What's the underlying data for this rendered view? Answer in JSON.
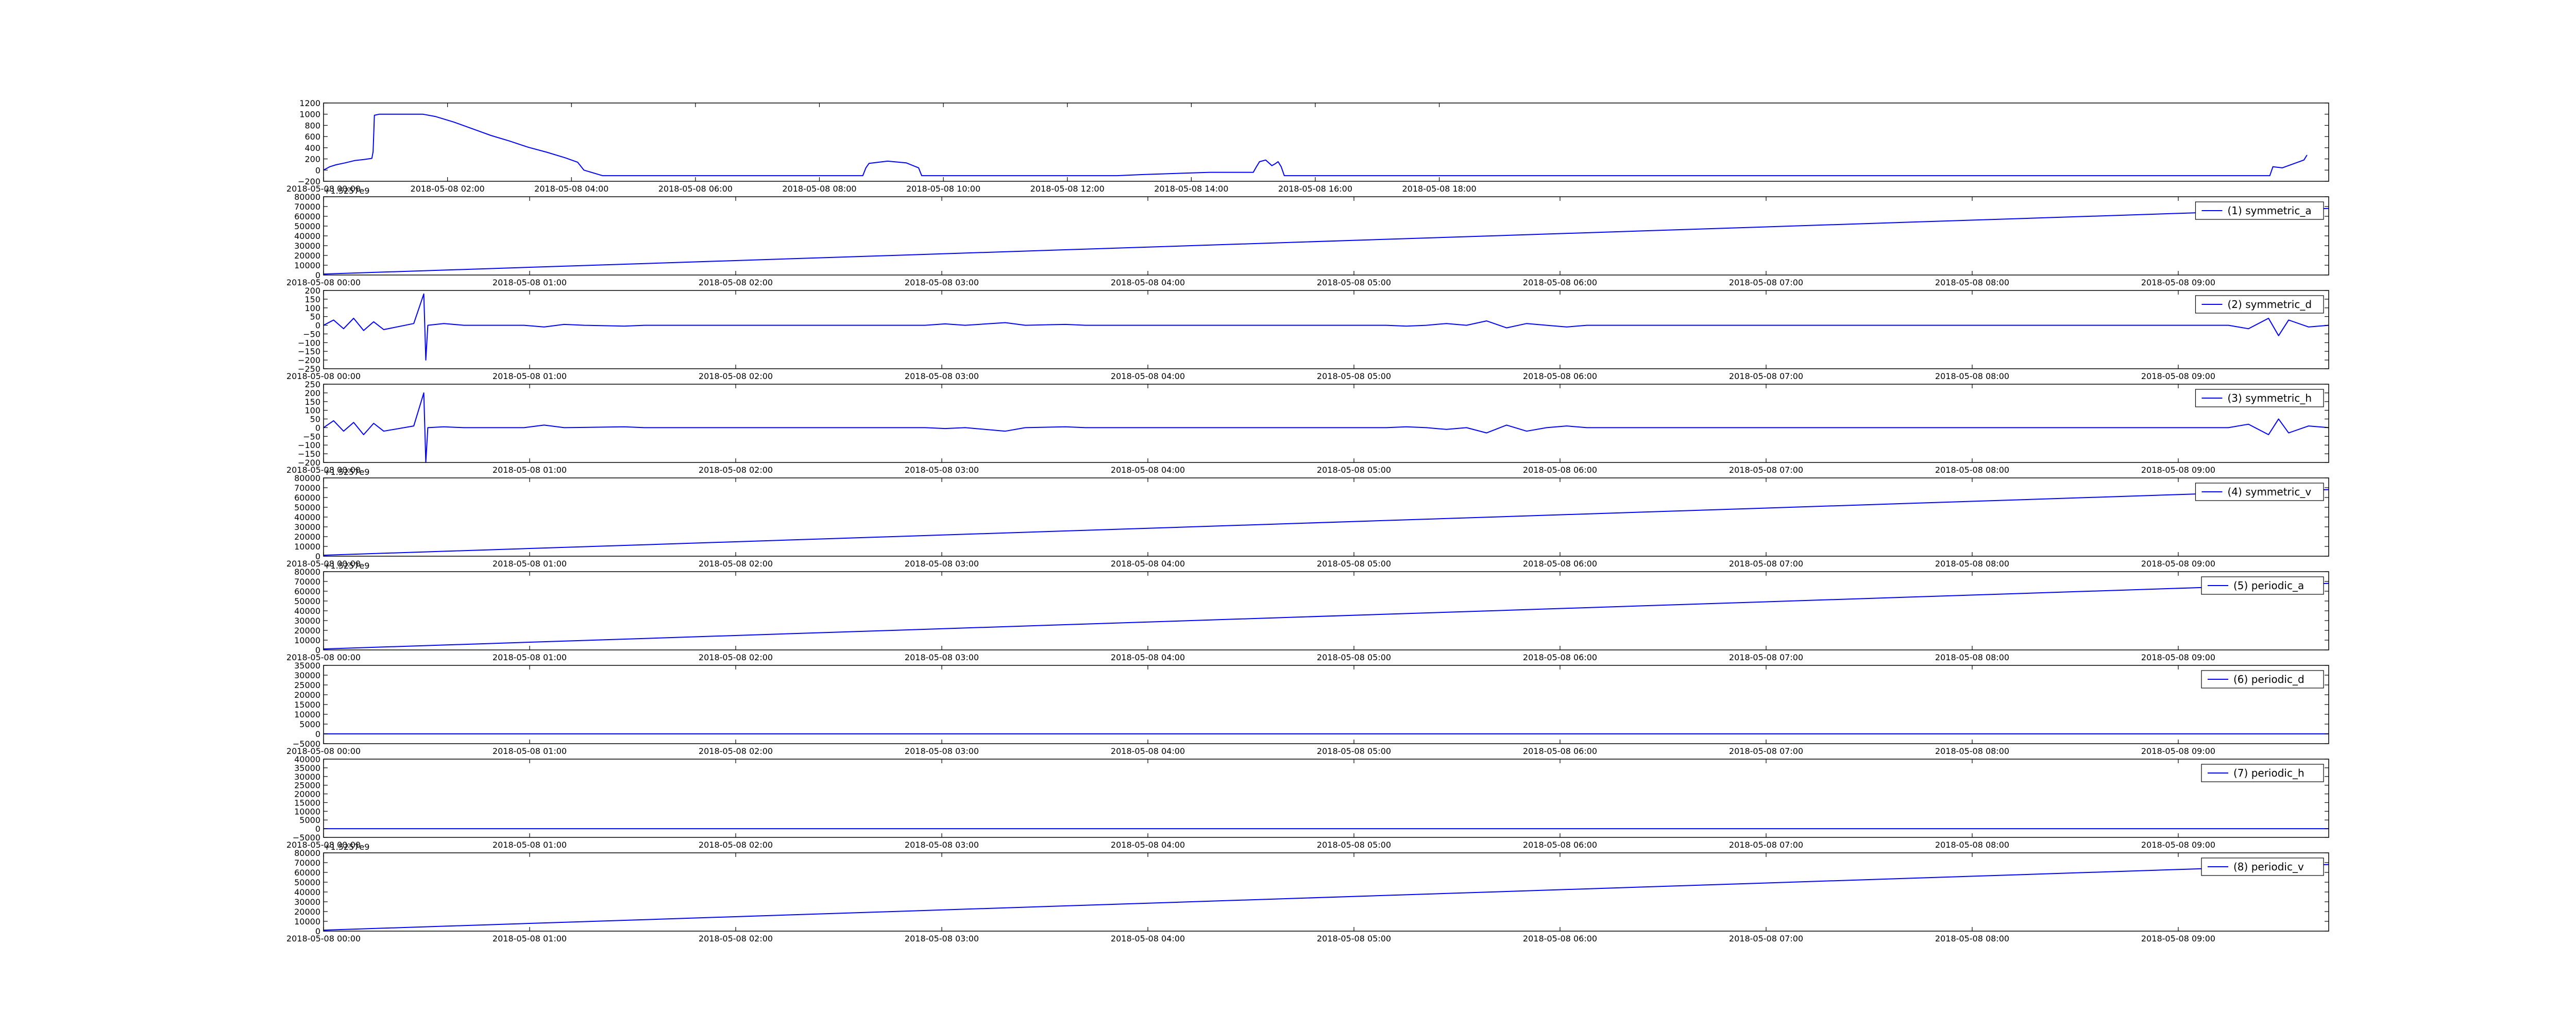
{
  "figure": {
    "line_color": "#0000ff",
    "legend_loc": "upper right"
  },
  "chart_data": [
    {
      "type": "line",
      "series": [
        {
          "values": [
            [
              0,
              0
            ],
            [
              0.1,
              60
            ],
            [
              0.2,
              95
            ],
            [
              0.35,
              130
            ],
            [
              0.5,
              170
            ],
            [
              0.65,
              190
            ],
            [
              0.78,
              210
            ],
            [
              0.8,
              330
            ],
            [
              0.82,
              980
            ],
            [
              0.9,
              1000
            ],
            [
              1.2,
              1000
            ],
            [
              1.6,
              1000
            ],
            [
              1.8,
              960
            ],
            [
              2.1,
              860
            ],
            [
              2.4,
              740
            ],
            [
              2.7,
              620
            ],
            [
              3.0,
              520
            ],
            [
              3.3,
              410
            ],
            [
              3.6,
              320
            ],
            [
              3.9,
              220
            ],
            [
              4.1,
              140
            ],
            [
              4.2,
              0
            ],
            [
              4.5,
              -100
            ],
            [
              5.0,
              -100
            ],
            [
              6.0,
              -100
            ],
            [
              7.0,
              -100
            ],
            [
              8.7,
              -100
            ],
            [
              8.75,
              40
            ],
            [
              8.8,
              120
            ],
            [
              9.1,
              160
            ],
            [
              9.4,
              130
            ],
            [
              9.6,
              40
            ],
            [
              9.65,
              -100
            ],
            [
              11.0,
              -100
            ],
            [
              12.8,
              -100
            ],
            [
              13.2,
              -80
            ],
            [
              14.3,
              -40
            ],
            [
              15.0,
              -40
            ],
            [
              15.05,
              60
            ],
            [
              15.1,
              150
            ],
            [
              15.2,
              180
            ],
            [
              15.3,
              80
            ],
            [
              15.35,
              110
            ],
            [
              15.4,
              150
            ],
            [
              15.45,
              60
            ],
            [
              15.5,
              -100
            ],
            [
              17.0,
              -100
            ],
            [
              18.0,
              -100
            ],
            [
              19.0,
              -100
            ],
            [
              20.0,
              -100
            ],
            [
              21.0,
              -100
            ],
            [
              22.0,
              -100
            ],
            [
              23.0,
              -100
            ],
            [
              24.0,
              -100
            ],
            [
              25.0,
              -100
            ],
            [
              26.0,
              -100
            ],
            [
              27.0,
              -100
            ],
            [
              28.0,
              -100
            ],
            [
              29.0,
              -100
            ],
            [
              30.0,
              -100
            ],
            [
              31.0,
              -100
            ],
            [
              31.4,
              -100
            ],
            [
              31.45,
              60
            ],
            [
              31.6,
              40
            ],
            [
              31.75,
              100
            ],
            [
              31.85,
              140
            ],
            [
              31.95,
              180
            ],
            [
              32.0,
              270
            ]
          ]
        }
      ],
      "x_axis": {
        "ticks": [
          "2018-05-08 00:00",
          "2018-05-08 02:00",
          "2018-05-08 04:00",
          "2018-05-08 06:00",
          "2018-05-08 08:00",
          "2018-05-08 10:00",
          "2018-05-08 12:00",
          "2018-05-08 14:00",
          "2018-05-08 16:00",
          "2018-05-08 18:00"
        ],
        "unit": "hour"
      },
      "ylim": [
        -200,
        1200
      ],
      "yticks": [
        "1200",
        "1000",
        "800",
        "600",
        "400",
        "200",
        "0",
        "−200"
      ],
      "xlim_hours": [
        0,
        32.35
      ],
      "offset_text": ""
    },
    {
      "type": "line",
      "series": [
        {
          "values": [
            [
              0,
              1000
            ],
            [
              1,
              68000
            ]
          ]
        }
      ],
      "x_axis": {
        "ticks": [
          "2018-05-08 00:00",
          "2018-05-08 01:00",
          "2018-05-08 02:00",
          "2018-05-08 03:00",
          "2018-05-08 04:00",
          "2018-05-08 05:00",
          "2018-05-08 06:00",
          "2018-05-08 07:00",
          "2018-05-08 08:00",
          "2018-05-08 09:00"
        ]
      },
      "ylim": [
        0,
        80000
      ],
      "yticks": [
        "80000",
        "70000",
        "60000",
        "50000",
        "40000",
        "30000",
        "20000",
        "10000",
        "0"
      ],
      "legend": [
        "(1) symmetric_a"
      ],
      "offset_text": "+1.5257e9"
    },
    {
      "type": "line",
      "series": [
        {
          "values": [
            [
              0,
              0
            ],
            [
              0.005,
              30
            ],
            [
              0.01,
              -20
            ],
            [
              0.015,
              40
            ],
            [
              0.02,
              -30
            ],
            [
              0.025,
              20
            ],
            [
              0.03,
              -25
            ],
            [
              0.045,
              10
            ],
            [
              0.05,
              180
            ],
            [
              0.051,
              -200
            ],
            [
              0.052,
              0
            ],
            [
              0.06,
              10
            ],
            [
              0.07,
              0
            ],
            [
              0.1,
              0
            ],
            [
              0.11,
              -10
            ],
            [
              0.12,
              5
            ],
            [
              0.13,
              0
            ],
            [
              0.15,
              -5
            ],
            [
              0.16,
              0
            ],
            [
              0.3,
              0
            ],
            [
              0.31,
              8
            ],
            [
              0.32,
              0
            ],
            [
              0.34,
              15
            ],
            [
              0.35,
              0
            ],
            [
              0.37,
              5
            ],
            [
              0.38,
              0
            ],
            [
              0.53,
              0
            ],
            [
              0.54,
              -5
            ],
            [
              0.55,
              0
            ],
            [
              0.56,
              10
            ],
            [
              0.57,
              0
            ],
            [
              0.58,
              25
            ],
            [
              0.59,
              -15
            ],
            [
              0.6,
              10
            ],
            [
              0.61,
              0
            ],
            [
              0.62,
              -10
            ],
            [
              0.63,
              0
            ],
            [
              0.95,
              0
            ],
            [
              0.96,
              -20
            ],
            [
              0.97,
              40
            ],
            [
              0.975,
              -60
            ],
            [
              0.98,
              30
            ],
            [
              0.99,
              -10
            ],
            [
              1,
              0
            ]
          ]
        }
      ],
      "x_axis": {
        "ticks": [
          "2018-05-08 00:00",
          "2018-05-08 01:00",
          "2018-05-08 02:00",
          "2018-05-08 03:00",
          "2018-05-08 04:00",
          "2018-05-08 05:00",
          "2018-05-08 06:00",
          "2018-05-08 07:00",
          "2018-05-08 08:00",
          "2018-05-08 09:00"
        ]
      },
      "ylim": [
        -250,
        200
      ],
      "yticks": [
        "200",
        "150",
        "100",
        "50",
        "0",
        "−50",
        "−100",
        "−150",
        "−200",
        "−250"
      ],
      "legend": [
        "(2) symmetric_d"
      ],
      "offset_text": ""
    },
    {
      "type": "line",
      "series": [
        {
          "values": [
            [
              0,
              0
            ],
            [
              0.005,
              40
            ],
            [
              0.01,
              -20
            ],
            [
              0.015,
              30
            ],
            [
              0.02,
              -40
            ],
            [
              0.025,
              25
            ],
            [
              0.03,
              -20
            ],
            [
              0.045,
              10
            ],
            [
              0.05,
              200
            ],
            [
              0.051,
              -200
            ],
            [
              0.052,
              0
            ],
            [
              0.06,
              5
            ],
            [
              0.07,
              0
            ],
            [
              0.1,
              0
            ],
            [
              0.11,
              15
            ],
            [
              0.12,
              0
            ],
            [
              0.15,
              5
            ],
            [
              0.16,
              0
            ],
            [
              0.3,
              0
            ],
            [
              0.31,
              -5
            ],
            [
              0.32,
              0
            ],
            [
              0.34,
              -20
            ],
            [
              0.35,
              0
            ],
            [
              0.37,
              5
            ],
            [
              0.38,
              0
            ],
            [
              0.53,
              0
            ],
            [
              0.54,
              5
            ],
            [
              0.55,
              0
            ],
            [
              0.56,
              -10
            ],
            [
              0.57,
              0
            ],
            [
              0.58,
              -30
            ],
            [
              0.59,
              15
            ],
            [
              0.6,
              -20
            ],
            [
              0.61,
              0
            ],
            [
              0.62,
              10
            ],
            [
              0.63,
              0
            ],
            [
              0.95,
              0
            ],
            [
              0.96,
              20
            ],
            [
              0.97,
              -40
            ],
            [
              0.975,
              50
            ],
            [
              0.98,
              -30
            ],
            [
              0.99,
              10
            ],
            [
              1,
              0
            ]
          ]
        }
      ],
      "x_axis": {
        "ticks": [
          "2018-05-08 00:00",
          "2018-05-08 01:00",
          "2018-05-08 02:00",
          "2018-05-08 03:00",
          "2018-05-08 04:00",
          "2018-05-08 05:00",
          "2018-05-08 06:00",
          "2018-05-08 07:00",
          "2018-05-08 08:00",
          "2018-05-08 09:00"
        ]
      },
      "ylim": [
        -200,
        250
      ],
      "yticks": [
        "250",
        "200",
        "150",
        "100",
        "50",
        "0",
        "−50",
        "−100",
        "−150",
        "−200"
      ],
      "legend": [
        "(3) symmetric_h"
      ],
      "offset_text": ""
    },
    {
      "type": "line",
      "series": [
        {
          "values": [
            [
              0,
              1000
            ],
            [
              1,
              68000
            ]
          ]
        }
      ],
      "x_axis": {
        "ticks": [
          "2018-05-08 00:00",
          "2018-05-08 01:00",
          "2018-05-08 02:00",
          "2018-05-08 03:00",
          "2018-05-08 04:00",
          "2018-05-08 05:00",
          "2018-05-08 06:00",
          "2018-05-08 07:00",
          "2018-05-08 08:00",
          "2018-05-08 09:00"
        ]
      },
      "ylim": [
        0,
        80000
      ],
      "yticks": [
        "80000",
        "70000",
        "60000",
        "50000",
        "40000",
        "30000",
        "20000",
        "10000",
        "0"
      ],
      "legend": [
        "(4) symmetric_v"
      ],
      "offset_text": "+1.5257e9"
    },
    {
      "type": "line",
      "series": [
        {
          "values": [
            [
              0,
              1000
            ],
            [
              1,
              68000
            ]
          ]
        }
      ],
      "x_axis": {
        "ticks": [
          "2018-05-08 00:00",
          "2018-05-08 01:00",
          "2018-05-08 02:00",
          "2018-05-08 03:00",
          "2018-05-08 04:00",
          "2018-05-08 05:00",
          "2018-05-08 06:00",
          "2018-05-08 07:00",
          "2018-05-08 08:00",
          "2018-05-08 09:00"
        ]
      },
      "ylim": [
        0,
        80000
      ],
      "yticks": [
        "80000",
        "70000",
        "60000",
        "50000",
        "40000",
        "30000",
        "20000",
        "10000",
        "0"
      ],
      "legend": [
        "(5) periodic_a"
      ],
      "offset_text": "+1.5257e9"
    },
    {
      "type": "line",
      "series": [
        {
          "values": [
            [
              0,
              0
            ],
            [
              1,
              0
            ]
          ]
        }
      ],
      "x_axis": {
        "ticks": [
          "2018-05-08 00:00",
          "2018-05-08 01:00",
          "2018-05-08 02:00",
          "2018-05-08 03:00",
          "2018-05-08 04:00",
          "2018-05-08 05:00",
          "2018-05-08 06:00",
          "2018-05-08 07:00",
          "2018-05-08 08:00",
          "2018-05-08 09:00"
        ]
      },
      "ylim": [
        -5000,
        35000
      ],
      "yticks": [
        "35000",
        "30000",
        "25000",
        "20000",
        "15000",
        "10000",
        "5000",
        "0",
        "−5000"
      ],
      "legend": [
        "(6) periodic_d"
      ],
      "offset_text": ""
    },
    {
      "type": "line",
      "series": [
        {
          "values": [
            [
              0,
              0
            ],
            [
              1,
              0
            ]
          ]
        }
      ],
      "x_axis": {
        "ticks": [
          "2018-05-08 00:00",
          "2018-05-08 01:00",
          "2018-05-08 02:00",
          "2018-05-08 03:00",
          "2018-05-08 04:00",
          "2018-05-08 05:00",
          "2018-05-08 06:00",
          "2018-05-08 07:00",
          "2018-05-08 08:00",
          "2018-05-08 09:00"
        ]
      },
      "ylim": [
        -5000,
        40000
      ],
      "yticks": [
        "40000",
        "35000",
        "30000",
        "25000",
        "20000",
        "15000",
        "10000",
        "5000",
        "0",
        "−5000"
      ],
      "legend": [
        "(7) periodic_h"
      ],
      "offset_text": ""
    },
    {
      "type": "line",
      "series": [
        {
          "values": [
            [
              0,
              1000
            ],
            [
              1,
              68000
            ]
          ]
        }
      ],
      "x_axis": {
        "ticks": [
          "2018-05-08 00:00",
          "2018-05-08 01:00",
          "2018-05-08 02:00",
          "2018-05-08 03:00",
          "2018-05-08 04:00",
          "2018-05-08 05:00",
          "2018-05-08 06:00",
          "2018-05-08 07:00",
          "2018-05-08 08:00",
          "2018-05-08 09:00"
        ]
      },
      "ylim": [
        0,
        80000
      ],
      "yticks": [
        "80000",
        "70000",
        "60000",
        "50000",
        "40000",
        "30000",
        "20000",
        "10000",
        "0"
      ],
      "legend": [
        "(8) periodic_v"
      ],
      "offset_text": "+1.5257e9"
    }
  ]
}
